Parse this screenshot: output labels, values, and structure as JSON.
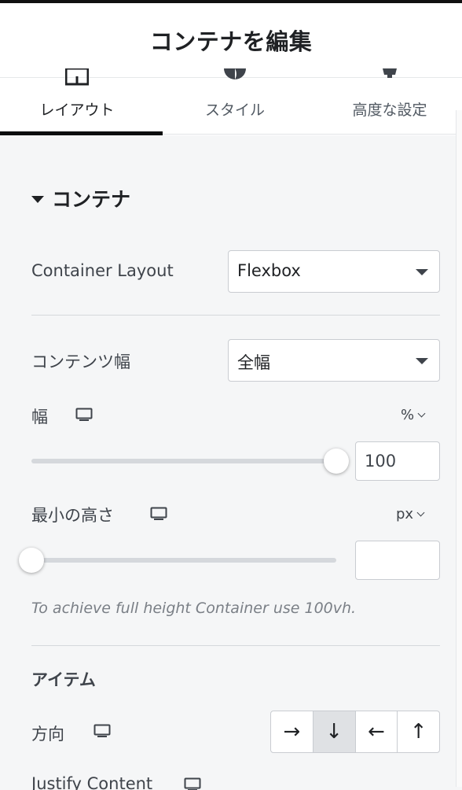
{
  "header": {
    "title": "コンテナを編集"
  },
  "tabs": [
    {
      "label": "レイアウト",
      "icon": "layout-icon",
      "active": true
    },
    {
      "label": "スタイル",
      "icon": "style-icon",
      "active": false
    },
    {
      "label": "高度な設定",
      "icon": "gear-icon",
      "active": false
    }
  ],
  "section": {
    "title": "コンテナ"
  },
  "container_layout": {
    "label": "Container Layout",
    "value": "Flexbox"
  },
  "content_width": {
    "label": "コンテンツ幅",
    "value": "全幅"
  },
  "width": {
    "label": "幅",
    "unit": "%",
    "value": "100",
    "slider_percent": 100
  },
  "min_height": {
    "label": "最小の高さ",
    "unit": "px",
    "value": "",
    "slider_percent": 0
  },
  "hint": "To achieve full height Container use 100vh.",
  "items": {
    "title": "アイテム",
    "direction": {
      "label": "方向",
      "options": [
        "→",
        "↓",
        "←",
        "↑"
      ],
      "selected_index": 1
    },
    "justify_content": {
      "label": "Justify Content"
    }
  },
  "colors": {
    "accent": "#0c0d0e",
    "panel_bg": "#f5f6f7",
    "active_button": "#dfe1e4"
  }
}
